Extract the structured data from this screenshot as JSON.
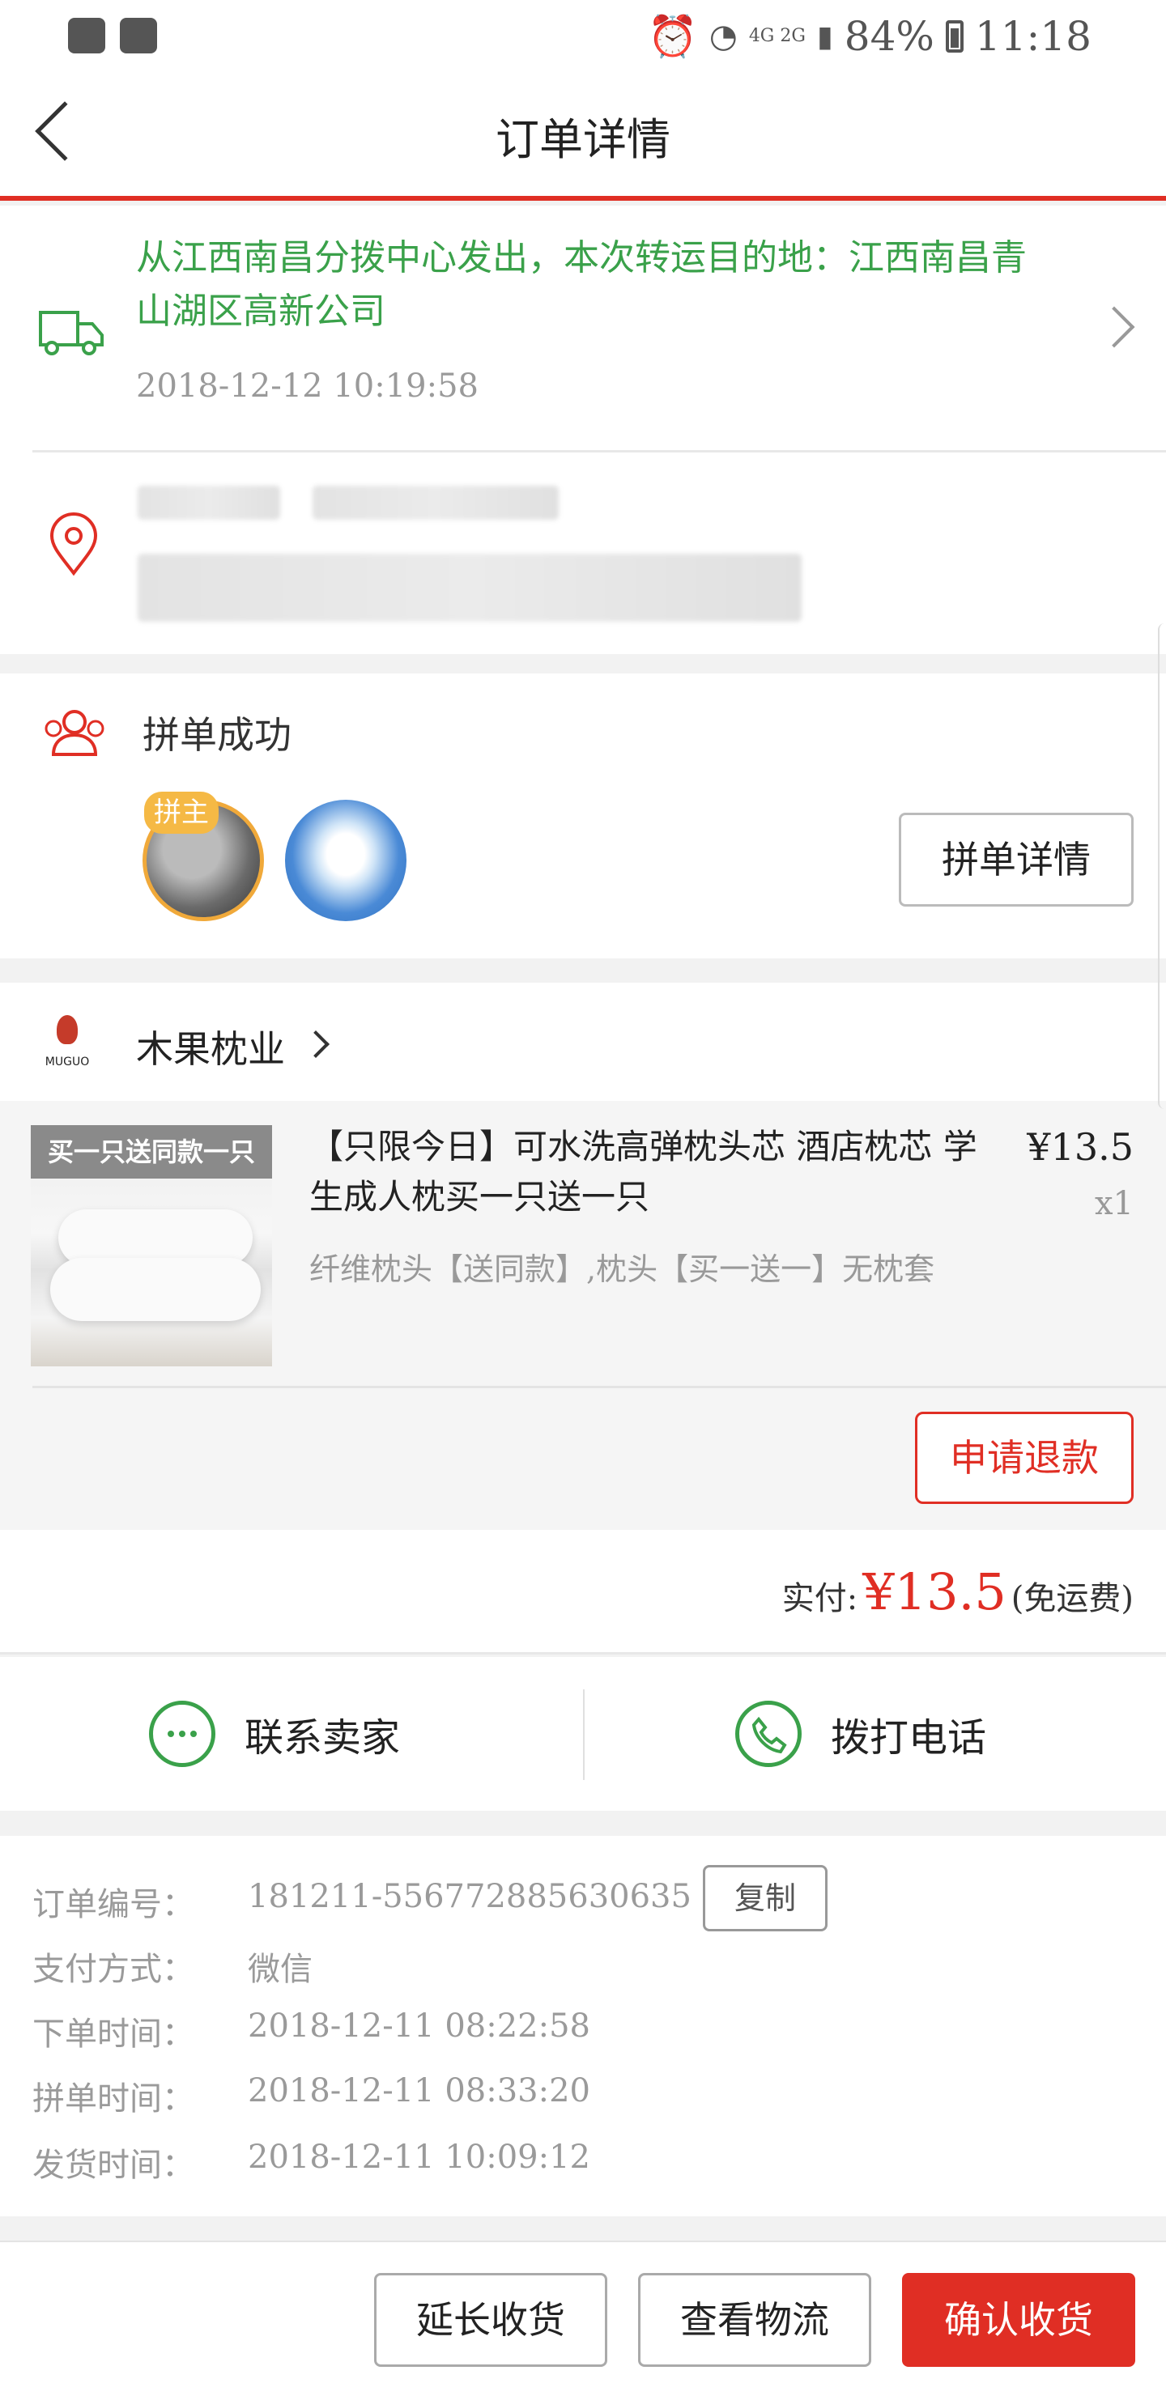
{
  "status_bar": {
    "network": "4G 2G",
    "battery": "84%",
    "time": "11:18"
  },
  "header": {
    "title": "订单详情"
  },
  "logistics": {
    "message": "从江西南昌分拨中心发出，本次转运目的地：江西南昌青山湖区高新公司",
    "time": "2018-12-12 10:19:58"
  },
  "group": {
    "status": "拼单成功",
    "host_badge": "拼主",
    "detail_button": "拼单详情"
  },
  "store": {
    "logo_text": "MUGUO",
    "name": "木果枕业"
  },
  "product": {
    "image_banner": "买一只送同款一只",
    "title": "【只限今日】可水洗高弹枕头芯 酒店枕芯 学生成人枕买一只送一只",
    "spec": "纤维枕头【送同款】,枕头【买一送一】无枕套",
    "price": "¥13.5",
    "quantity": "x1",
    "refund_button": "申请退款"
  },
  "payment": {
    "label": "实付:",
    "amount": "¥13.5",
    "note": "(免运费)"
  },
  "contact": {
    "seller_label": "联系卖家",
    "phone_label": "拨打电话"
  },
  "order_info": {
    "order_no_label": "订单编号：",
    "order_no": "181211-556772885630635",
    "copy_button": "复制",
    "pay_method_label": "支付方式：",
    "pay_method": "微信",
    "order_time_label": "下单时间：",
    "order_time": "2018-12-11 08:22:58",
    "group_time_label": "拼单时间：",
    "group_time": "2018-12-11 08:33:20",
    "ship_time_label": "发货时间：",
    "ship_time": "2018-12-11 10:09:12"
  },
  "bottom_bar": {
    "extend_button": "延长收货",
    "logistics_button": "查看物流",
    "confirm_button": "确认收货"
  },
  "colors": {
    "accent": "#e02e24",
    "logistics_green": "#3aa14a",
    "host_badge": "#f5b945"
  }
}
